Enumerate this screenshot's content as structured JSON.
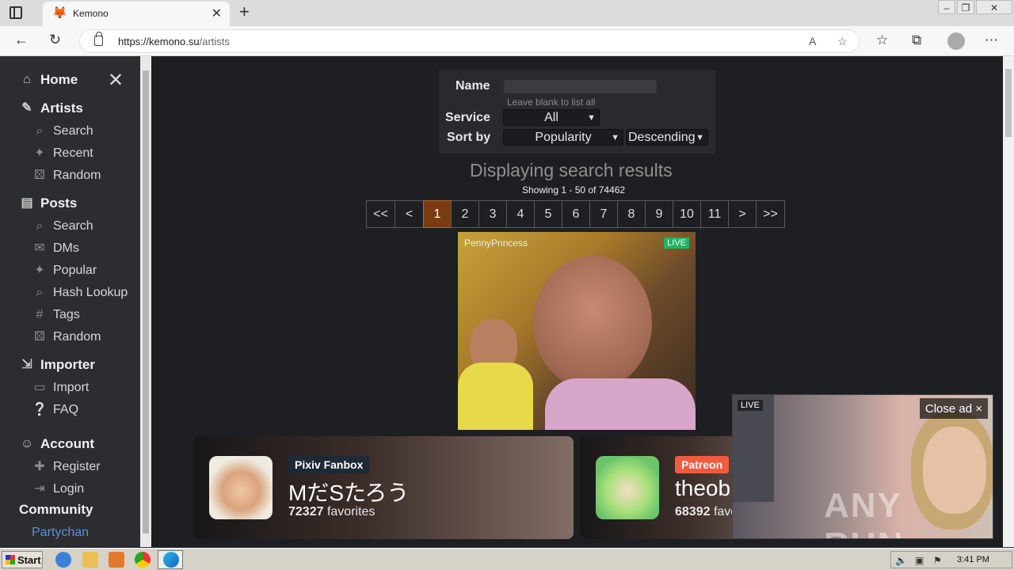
{
  "browser": {
    "tab_title": "Kemono",
    "url_host": "https://kemono.su",
    "url_path": "/artists"
  },
  "sidebar": {
    "home": "Home",
    "sections": {
      "artists": {
        "label": "Artists",
        "items": [
          "Search",
          "Recent",
          "Random"
        ]
      },
      "posts": {
        "label": "Posts",
        "items": [
          "Search",
          "DMs",
          "Popular",
          "Hash Lookup",
          "Tags",
          "Random"
        ]
      },
      "importer": {
        "label": "Importer",
        "items": [
          "Import",
          "FAQ"
        ]
      },
      "account": {
        "label": "Account",
        "items": [
          "Register",
          "Login"
        ]
      }
    },
    "community": "Community",
    "partychan": "Partychan"
  },
  "search_form": {
    "name_label": "Name",
    "name_value": "",
    "name_hint": "Leave blank to list all",
    "service_label": "Service",
    "service_value": "All",
    "sort_label": "Sort by",
    "sort_value": "Popularity",
    "order_value": "Descending"
  },
  "results": {
    "title": "Displaying search results",
    "showing": "Showing 1 - 50 of 74462"
  },
  "pagination": {
    "first": "<<",
    "prev": "<",
    "pages": [
      "1",
      "2",
      "3",
      "4",
      "5",
      "6",
      "7",
      "8",
      "9",
      "10",
      "11"
    ],
    "active": "1",
    "next": ">",
    "last": ">>"
  },
  "ad_top": {
    "username": "PennyPrincess",
    "live": "LIVE"
  },
  "cards": [
    {
      "service": "Pixiv Fanbox",
      "service_color": "#1e2a37",
      "name": "MだSたろう",
      "favorites": "72327",
      "favorites_label": "favorites"
    },
    {
      "service": "Patreon",
      "service_color": "#f15a3e",
      "name": "theob",
      "favorites": "68392",
      "favorites_label": "favo"
    }
  ],
  "ad_bottom": {
    "live": "LIVE",
    "close": "Close ad",
    "close_x": "×",
    "watermark": "ANY RUN"
  },
  "taskbar": {
    "start": "Start",
    "clock": "3:41 PM"
  }
}
